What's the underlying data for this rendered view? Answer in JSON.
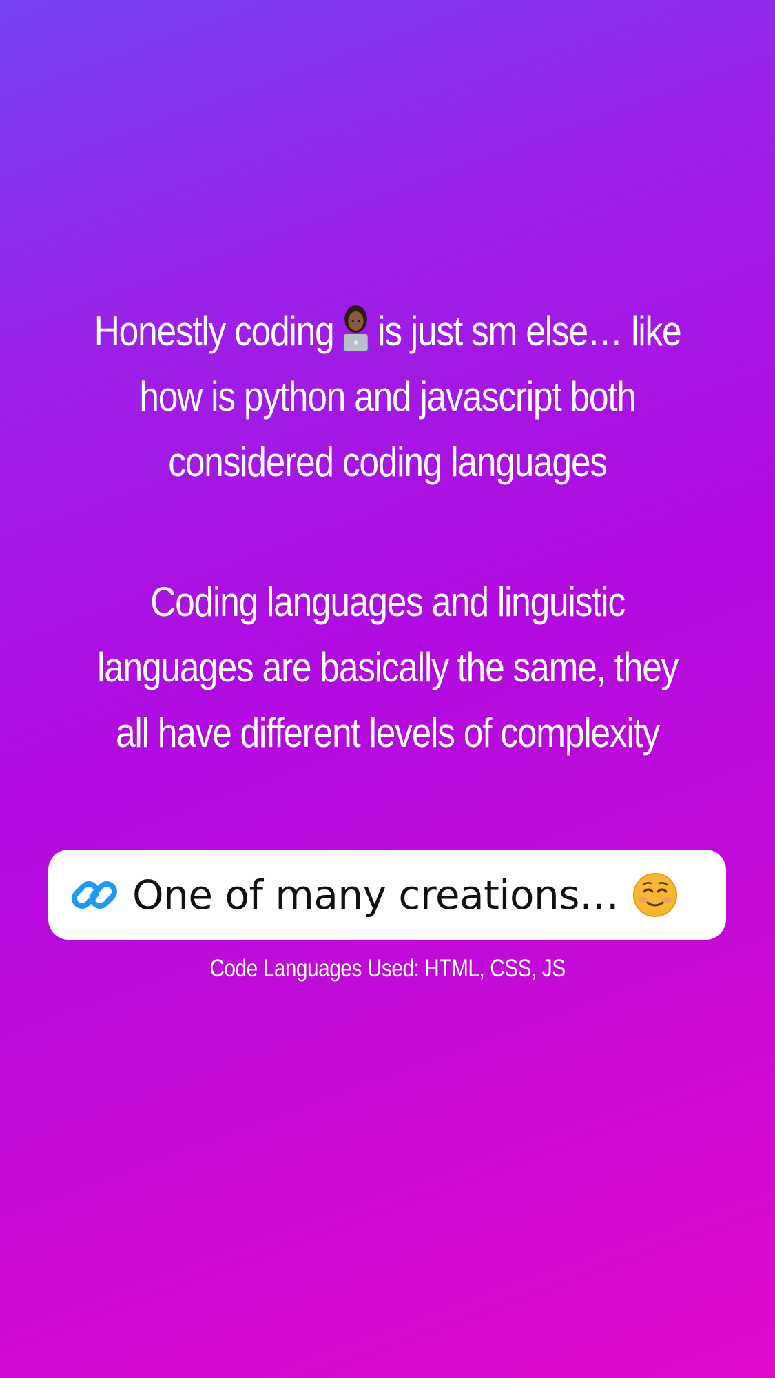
{
  "story": {
    "paragraph_1": {
      "before_emoji": "Honestly coding",
      "after_emoji": "is just sm else… like",
      "line_2": "how is python and javascript both",
      "line_3": "considered coding languages",
      "emoji_icon": "woman-technologist-icon"
    },
    "paragraph_2": {
      "line_1": "Coding languages and linguistic",
      "line_2": "languages are basically the same, they",
      "line_3": "all have different levels of complexity"
    }
  },
  "link_sticker": {
    "label": "One of many creations…",
    "icon": "link-icon",
    "emoji": "smiling-face-icon",
    "icon_color": "#1d9bf0"
  },
  "caption": "Code Languages Used: HTML, CSS, JS",
  "colors": {
    "gradient_start": "#7443f2",
    "gradient_end": "#e00acb",
    "text": "#ffffff",
    "sticker_bg": "#ffffff"
  }
}
